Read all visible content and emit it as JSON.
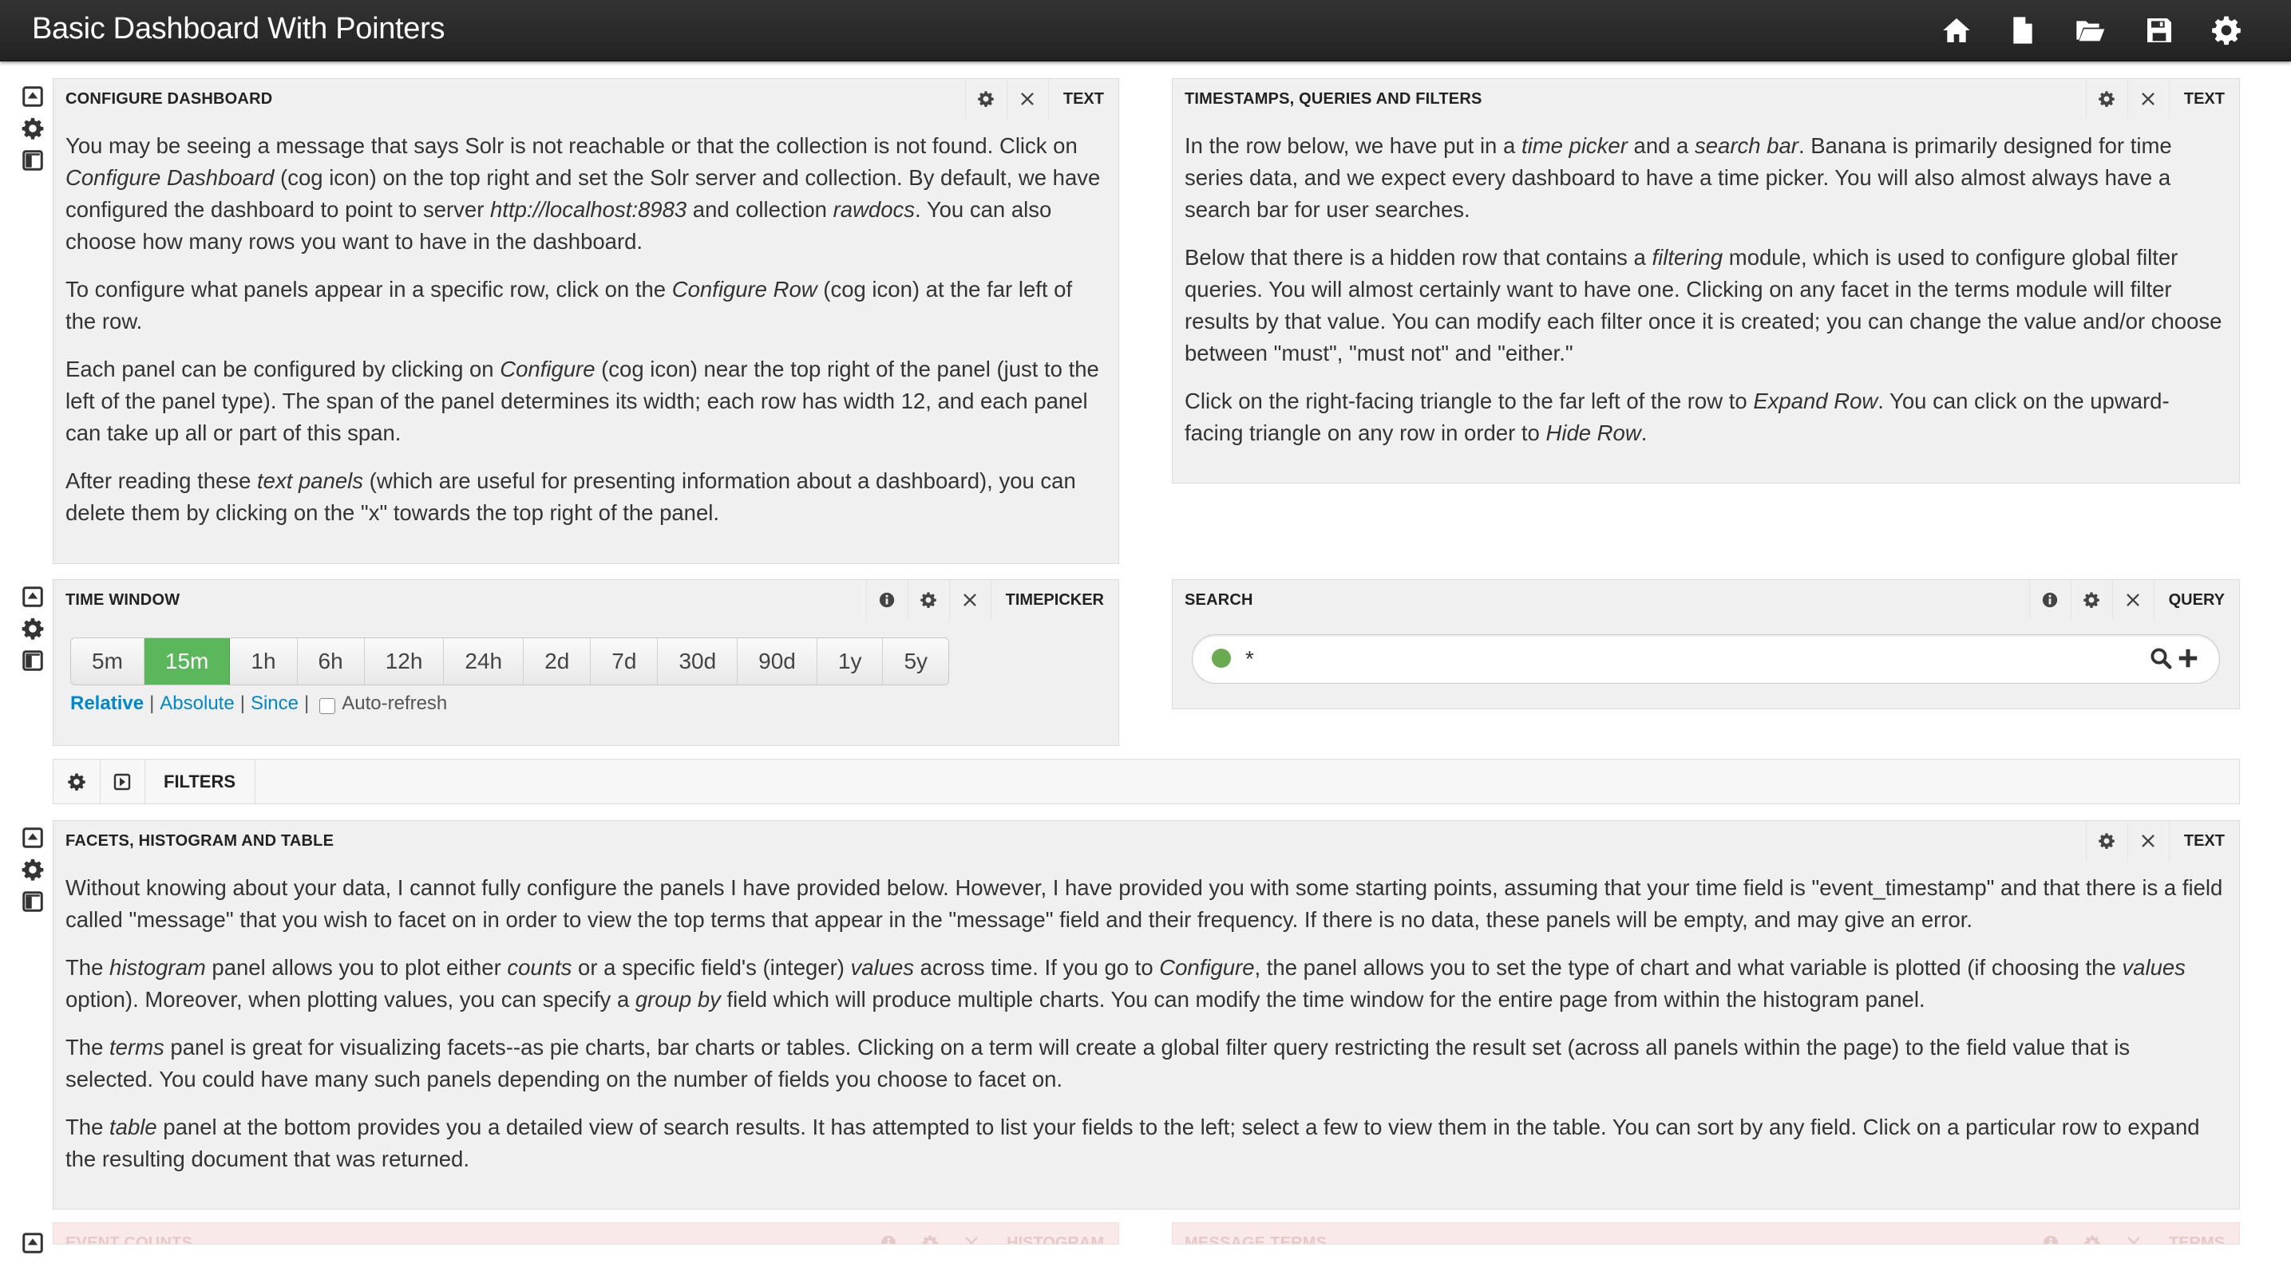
{
  "app": {
    "title": "Basic Dashboard With Pointers"
  },
  "nav": [
    {
      "name": "home-icon"
    },
    {
      "name": "new-file-icon"
    },
    {
      "name": "open-folder-icon"
    },
    {
      "name": "save-icon"
    },
    {
      "name": "settings-gear-icon"
    }
  ],
  "panels": {
    "configure": {
      "title": "CONFIGURE DASHBOARD",
      "type": "TEXT",
      "p1": [
        "You may be seeing a message that says Solr is not reachable or that the collection is not found. Click on ",
        "Configure Dashboard",
        " (cog icon) on the top right and set the Solr server and collection. By default, we have configured the dashboard to point to server ",
        "http://localhost:8983",
        " and collection ",
        "rawdocs",
        ". You can also choose how many rows you want to have in the dashboard."
      ],
      "p2": [
        "To configure what panels appear in a specific row, click on the ",
        "Configure Row",
        " (cog icon) at the far left of the row."
      ],
      "p3": [
        "Each panel can be configured by clicking on ",
        "Configure",
        " (cog icon) near the top right of the panel (just to the left of the panel type). The span of the panel determines its width; each row has width 12, and each panel can take up all or part of this span."
      ],
      "p4": [
        "After reading these ",
        "text panels",
        " (which are useful for presenting information about a dashboard), you can delete them by clicking on the \"x\" towards the top right of the panel."
      ]
    },
    "timestamps": {
      "title": "TIMESTAMPS, QUERIES AND FILTERS",
      "type": "TEXT",
      "p1": [
        "In the row below, we have put in a ",
        "time picker",
        " and a ",
        "search bar",
        ". Banana is primarily designed for time series data, and we expect every dashboard to have a time picker. You will also almost always have a search bar for user searches."
      ],
      "p2": [
        "Below that there is a hidden row that contains a ",
        "filtering",
        " module, which is used to configure global filter queries. You will almost certainly want to have one. Clicking on any facet in the terms module will filter results by that value. You can modify each filter once it is created; you can change the value and/or choose between \"must\", \"must not\" and \"either.\""
      ],
      "p3": [
        "Click on the right-facing triangle to the far left of the row to ",
        "Expand Row",
        ". You can click on the upward-facing triangle on any row in order to ",
        "Hide Row",
        "."
      ]
    },
    "timewindow": {
      "title": "TIME WINDOW",
      "type": "TIMEPICKER",
      "options": [
        "5m",
        "15m",
        "1h",
        "6h",
        "12h",
        "24h",
        "2d",
        "7d",
        "30d",
        "90d",
        "1y",
        "5y"
      ],
      "selected": "15m",
      "modes": [
        "Relative",
        "Absolute",
        "Since"
      ],
      "mode_sep": "|",
      "autorefresh_label": "Auto-refresh"
    },
    "search": {
      "title": "SEARCH",
      "type": "QUERY",
      "query": "*",
      "dot_color": "#6aaa51"
    },
    "filters": {
      "label": "FILTERS"
    },
    "facets": {
      "title": "FACETS, HISTOGRAM AND TABLE",
      "type": "TEXT",
      "p1": [
        "Without knowing about your data, I cannot fully configure the panels I have provided below. However, I have provided you with some starting points, assuming that your time field is \"event_timestamp\" and that there is a field called \"message\" that you wish to facet on in order to view the top terms that appear in the \"message\" field and their frequency. If there is no data, these panels will be empty, and may give an error."
      ],
      "p2": [
        "The ",
        "histogram",
        " panel allows you to plot either ",
        "counts",
        " or a specific field's (integer) ",
        "values",
        " across time. If you go to ",
        "Configure",
        ", the panel allows you to set the type of chart and what variable is plotted (if choosing the ",
        "values",
        " option). Moreover, when plotting values, you can specify a ",
        "group by",
        " field which will produce multiple charts. You can modify the time window for the entire page from within the histogram panel."
      ],
      "p3": [
        "The ",
        "terms",
        " panel is great for visualizing facets--as pie charts, bar charts or tables. Clicking on a term will create a global filter query restricting the result set (across all panels within the page) to the field value that is selected. You could have many such panels depending on the number of fields you choose to facet on."
      ],
      "p4": [
        "The ",
        "table",
        " panel at the bottom provides you a detailed view of search results. It has attempted to list your fields to the left; select a few to view them in the table. You can sort by any field. Click on a particular row to expand the resulting document that was returned."
      ]
    },
    "eventcounts": {
      "title": "EVENT COUNTS",
      "type": "HISTOGRAM"
    },
    "messageterms": {
      "title": "MESSAGE TERMS",
      "type": "TERMS"
    }
  },
  "colors": {
    "accent": "#5bb75b",
    "link": "#0088cc",
    "panel_bg": "#f0f0f0",
    "topbar": "#2b2b2b"
  }
}
